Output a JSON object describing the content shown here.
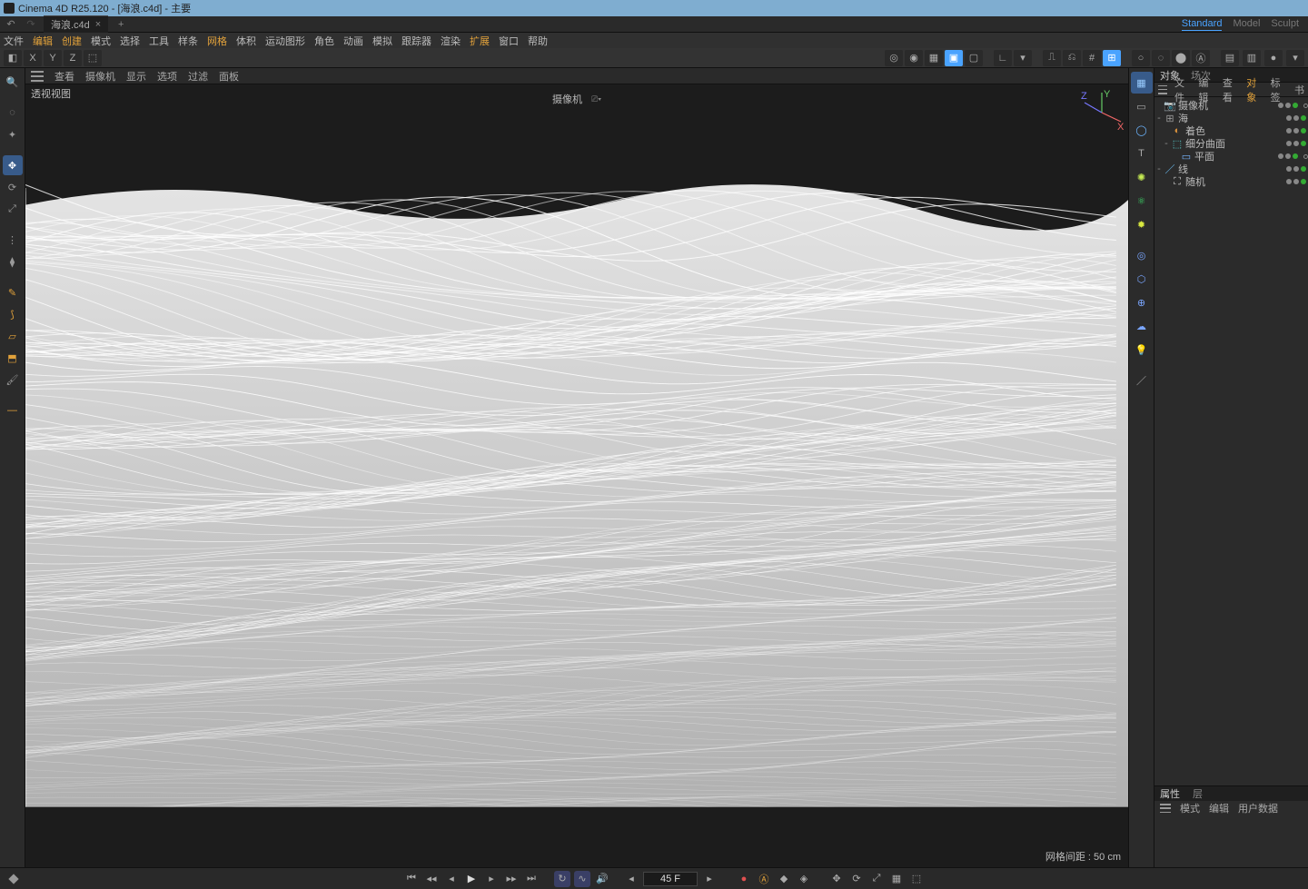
{
  "title": "Cinema 4D R25.120 - [海浪.c4d] - 主要",
  "tab_file": "海浪.c4d",
  "layout_tabs": [
    "Standard",
    "Model",
    "Sculpt"
  ],
  "layout_active": "Standard",
  "menu": {
    "items": [
      "文件",
      "编辑",
      "创建",
      "模式",
      "选择",
      "工具",
      "样条",
      "网格",
      "体积",
      "运动图形",
      "角色",
      "动画",
      "模拟",
      "跟踪器",
      "渲染",
      "扩展",
      "窗口",
      "帮助"
    ],
    "highlighted": [
      "编辑",
      "创建",
      "网格",
      "扩展"
    ]
  },
  "axis": {
    "x": "X",
    "y": "Y",
    "z": "Z"
  },
  "viewport": {
    "menu": [
      "查看",
      "摄像机",
      "显示",
      "选项",
      "过滤",
      "面板"
    ],
    "name": "透视视图",
    "camera_label": "摄像机",
    "grid_label": "网格间距 : 50 cm",
    "gizmo": {
      "x": "X",
      "y": "Y",
      "z": "Z"
    }
  },
  "objects_panel": {
    "tabs": [
      "对象",
      "场次"
    ],
    "tabs_active": "对象",
    "menu": [
      "文件",
      "编辑",
      "查看",
      "对象",
      "标签",
      "书"
    ],
    "menu_active": "对象",
    "tree": [
      {
        "level": 0,
        "expand": "",
        "icon": "cam",
        "name": "摄像机",
        "tag": "target"
      },
      {
        "level": 0,
        "expand": "-",
        "icon": "null",
        "name": "海",
        "tag": ""
      },
      {
        "level": 1,
        "expand": "",
        "icon": "shader",
        "name": "着色",
        "tag": ""
      },
      {
        "level": 1,
        "expand": "-",
        "icon": "sds",
        "name": "细分曲面",
        "tag": ""
      },
      {
        "level": 2,
        "expand": "",
        "icon": "plane",
        "name": "平面",
        "tag": "phong"
      },
      {
        "level": 0,
        "expand": "-",
        "icon": "line",
        "name": "线",
        "tag": ""
      },
      {
        "level": 1,
        "expand": "",
        "icon": "random",
        "name": "随机",
        "tag": ""
      }
    ]
  },
  "attributes_panel": {
    "tabs": [
      "属性",
      "层"
    ],
    "tabs_active": "属性",
    "menu": [
      "模式",
      "编辑",
      "用户数据"
    ]
  },
  "timeline": {
    "frame": "45 F"
  }
}
